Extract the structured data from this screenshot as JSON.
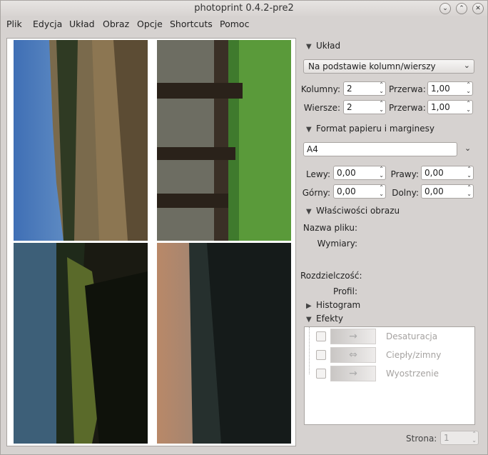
{
  "window": {
    "title": "photoprint 0.4.2-pre2"
  },
  "titlebar_buttons": {
    "minimize": "⌄",
    "maximize": "⌃",
    "close": "✕"
  },
  "menu": [
    "Plik",
    "Edycja",
    "Układ",
    "Obraz",
    "Opcje",
    "Shortcuts",
    "Pomoc"
  ],
  "layout_section": {
    "title": "Układ",
    "mode": "Na podstawie kolumn/wierszy",
    "columns_label": "Kolumny:",
    "columns_value": "2",
    "rows_label": "Wiersze:",
    "rows_value": "2",
    "gap1_label": "Przerwa:",
    "gap1_value": "1,00",
    "gap2_label": "Przerwa:",
    "gap2_value": "1,00"
  },
  "paper_section": {
    "title": "Format papieru i marginesy",
    "paper": "A4",
    "left_label": "Lewy:",
    "left_value": "0,00",
    "right_label": "Prawy:",
    "right_value": "0,00",
    "top_label": "Górny:",
    "top_value": "0,00",
    "bottom_label": "Dolny:",
    "bottom_value": "0,00"
  },
  "image_section": {
    "title": "Właściwości obrazu",
    "filename_label": "Nazwa pliku:",
    "dimensions_label": "Wymiary:",
    "resolution_label": "Rozdzielczość:",
    "profile_label": "Profil:"
  },
  "histogram_section": {
    "title": "Histogram"
  },
  "effects_section": {
    "title": "Efekty",
    "items": [
      {
        "label": "Desaturacja",
        "icon": "→"
      },
      {
        "label": "Ciepły/zimny",
        "icon": "⇔"
      },
      {
        "label": "Wyostrzenie",
        "icon": "→"
      }
    ]
  },
  "pager": {
    "label": "Strona:",
    "value": "1"
  }
}
